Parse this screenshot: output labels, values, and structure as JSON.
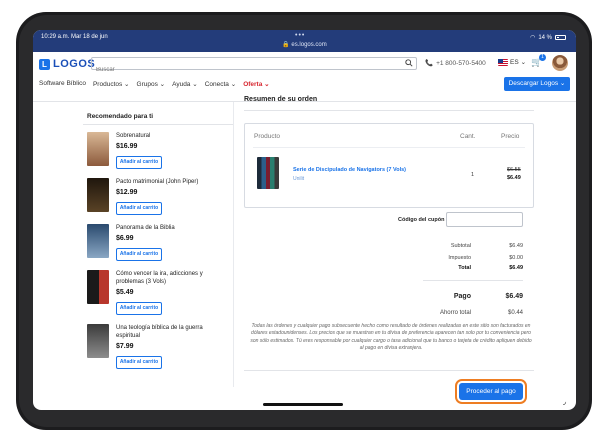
{
  "status_bar": {
    "time_date": "10:29 a.m.   Mar 18 de jun",
    "url": "es.logos.com",
    "battery": "14 %"
  },
  "header": {
    "logo_text": "LOGOS",
    "search_placeholder": "Buscar",
    "phone": "+1 800-570-5400",
    "language": "ES",
    "cart_count": "1",
    "nav": [
      "Software Bíblico",
      "Productos",
      "Grupos",
      "Ayuda",
      "Conecta",
      "Oferta"
    ],
    "download_button": "Descargar Logos"
  },
  "sidebar": {
    "title": "Recomendado para ti",
    "items": [
      {
        "title": "Sobrenatural",
        "price": "$16.99",
        "button": "Añadir al carrito"
      },
      {
        "title": "Pacto matrimonial (John Piper)",
        "price": "$12.99",
        "button": "Añadir al carrito"
      },
      {
        "title": "Panorama de la Biblia",
        "price": "$6.99",
        "button": "Añadir al carrito"
      },
      {
        "title": "Cómo vencer la ira, adicciones y problemas (3 Vols)",
        "price": "$5.49",
        "button": "Añadir al carrito"
      },
      {
        "title": "Una teología bíblica de la guerra espiritual",
        "price": "$7.99",
        "button": "Añadir al carrito"
      }
    ],
    "cover_colors": [
      "#c9a07a",
      "#3a2a1a",
      "#4b6f96",
      "#2a2a2a",
      "#6b6b6b"
    ]
  },
  "order": {
    "title": "Resumen de su orden",
    "headers": {
      "product": "Producto",
      "qty": "Cant.",
      "price": "Precio"
    },
    "item": {
      "name": "Serie de Discipulado de Navigators (7 Vols)",
      "publisher": "Unilit",
      "qty": "1",
      "old_price": "$6.55",
      "new_price": "$6.49"
    },
    "coupon_label": "Código del cupón",
    "summary": [
      {
        "label": "Subtotal",
        "value": "$6.49"
      },
      {
        "label": "Impuesto",
        "value": "$0.00"
      },
      {
        "label": "Total",
        "value": "$6.49"
      }
    ],
    "pago": {
      "label": "Pago",
      "value": "$6.49"
    },
    "ahorro": {
      "label": "Ahorro total",
      "value": "$0.44"
    },
    "disclaimer": "Todas las órdenes y cualquier pago subsecuente hecho como resultado de órdenes realizadas en este sitio son facturados en dólares estadounidenses. Los precios que se muestran en tu divisa de preferencia aparecen tan solo por tu conveniencia pero son sólo estimados. Tú eres responsable por cualquier cargo o tasa adicional que tu banco o tarjeta de crédito apliquen debido al pago en divisa extranjera.",
    "proceed_button": "Proceder al pago"
  },
  "colors": {
    "brand_blue": "#1a73e8",
    "status_bar": "#233c7a",
    "highlight_ring": "#ee7d22",
    "sale_red": "#d7262f"
  }
}
